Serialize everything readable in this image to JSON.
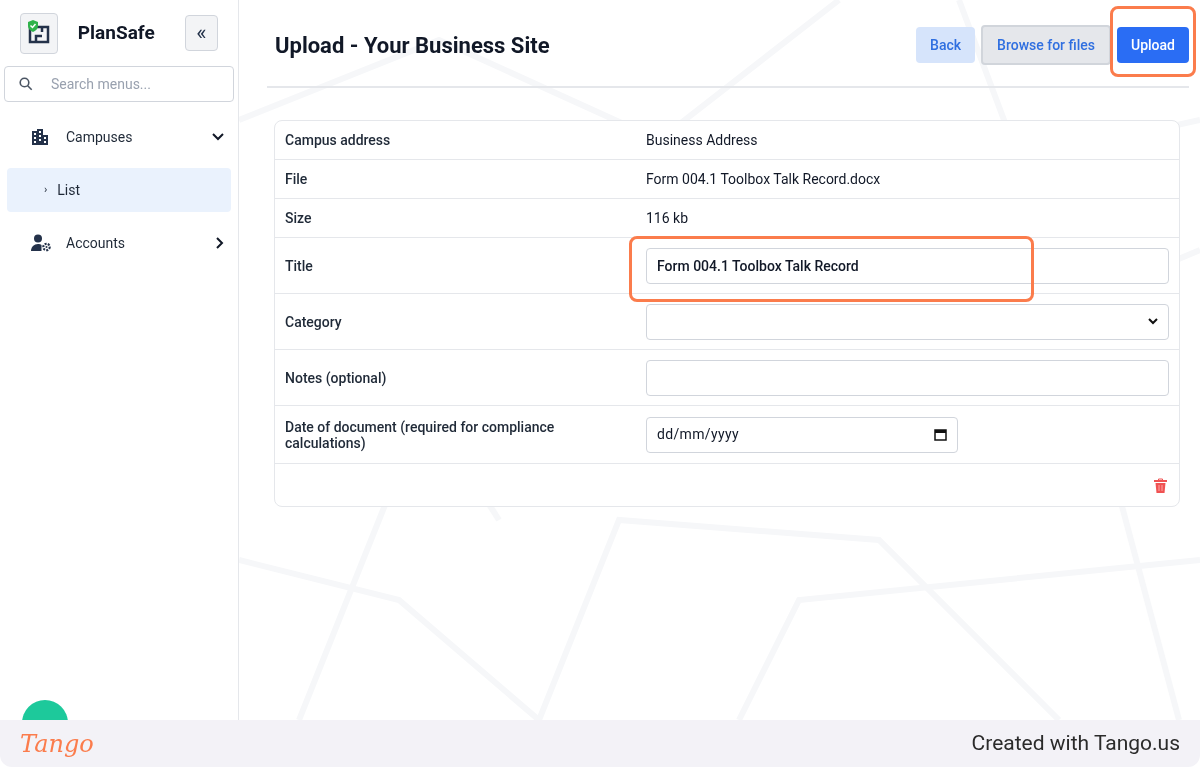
{
  "sidebar": {
    "brand": "PlanSafe",
    "collapse_label": "«",
    "search": {
      "placeholder": "Search menus..."
    },
    "items": [
      {
        "label": "Campuses",
        "kind": "building",
        "expanded": true,
        "children": [
          {
            "label": "List",
            "marker": "›",
            "selected": true
          }
        ]
      },
      {
        "label": "Accounts",
        "kind": "user-gear",
        "expanded": false
      }
    ]
  },
  "page": {
    "title": "Upload - Your Business Site",
    "buttons": [
      {
        "label": "Back",
        "kind": "light",
        "highlighted": false
      },
      {
        "label": "Browse for files",
        "kind": "grey",
        "highlighted": false
      },
      {
        "label": "Upload",
        "kind": "primary",
        "highlighted": true
      }
    ]
  },
  "form": {
    "rows": [
      {
        "label": "Campus address",
        "kind": "text",
        "value": "Business Address"
      },
      {
        "label": "File",
        "kind": "text",
        "value": "Form 004.1 Toolbox Talk Record.docx"
      },
      {
        "label": "Size",
        "kind": "text",
        "value": "116 kb"
      },
      {
        "label": "Title",
        "kind": "input",
        "value": "Form 004.1 Toolbox Talk Record",
        "highlighted": true
      },
      {
        "label": "Category",
        "kind": "select"
      },
      {
        "label": "Notes (optional)",
        "kind": "input"
      },
      {
        "label": "Date of document (required for compliance calculations)",
        "kind": "date",
        "placeholder": "dd/mm/yyyy"
      }
    ]
  },
  "footer": {
    "brand": "Tango",
    "credit": "Created with Tango.us"
  }
}
